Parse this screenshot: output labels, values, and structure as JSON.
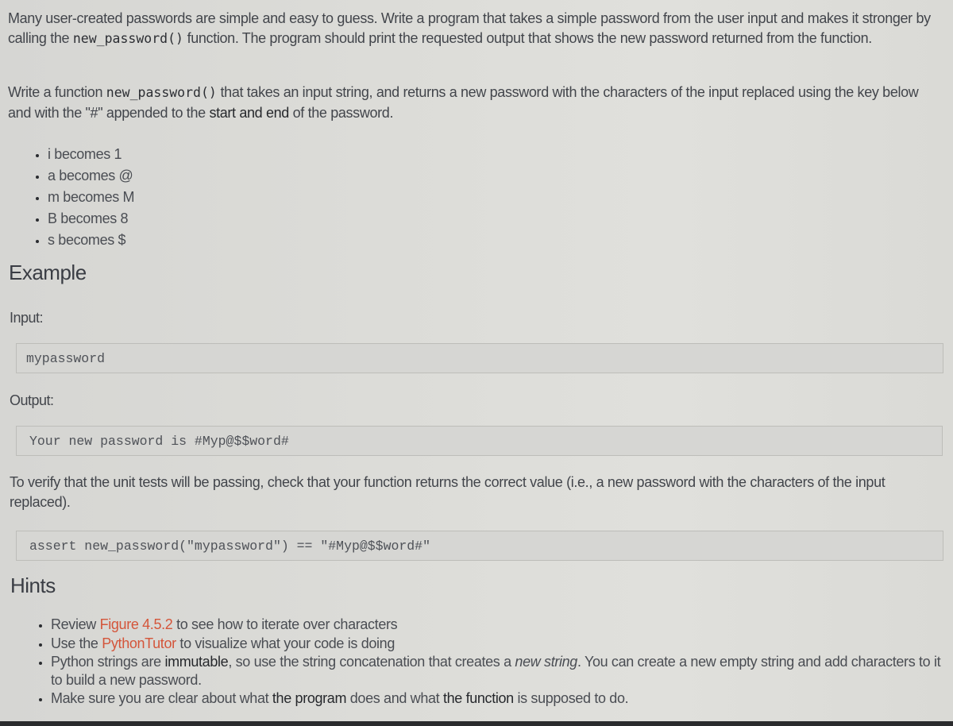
{
  "intro": {
    "part1": "Many user-created passwords are simple and easy to guess. Write a program that takes a simple password from the user input and makes it stronger by calling the ",
    "function_name": "new_password()",
    "part2": " function. The program should print the requested output that shows the new password returned from the function."
  },
  "task": {
    "part1": "Write a function ",
    "function_name": "new_password()",
    "part2": " that takes an input string, and returns a new password with the characters of the input replaced using the key below and with the \"#\" appended to the ",
    "bold": "start and end",
    "part3": " of the password."
  },
  "key_rules": [
    "i becomes 1",
    "a becomes @",
    "m becomes M",
    "B becomes 8",
    "s becomes $"
  ],
  "example": {
    "heading": "Example",
    "input_label": "Input:",
    "input_value": "mypassword",
    "output_label": "Output:",
    "output_value": "Your new password is #Myp@$$word#"
  },
  "verify": {
    "text": "To verify that the unit tests will be passing, check that your function returns the correct value (i.e., a new password with the characters of the input replaced).",
    "assert_code": "assert new_password(\"mypassword\") == \"#Myp@$$word#\""
  },
  "hints": {
    "heading": "Hints",
    "items": [
      {
        "pre": "Review ",
        "link": "Figure 4.5.2",
        "post": " to see how to iterate over characters"
      },
      {
        "pre": "Use the ",
        "link": "PythonTutor",
        "post": " to visualize what your code is doing"
      },
      {
        "pre": "Python strings are ",
        "bold": "immutable",
        "mid": ", so use the string concatenation that creates a ",
        "italic": "new string",
        "post": ". You can create a new empty string and add characters to it to build a new password."
      },
      {
        "pre": "Make sure you are clear about what ",
        "bold1": "the program",
        "mid": " does and what ",
        "bold2": "the function",
        "post": " is supposed to do."
      }
    ]
  },
  "colors": {
    "link": "#d4553a",
    "text": "#42454b",
    "code_box_bg": "#d6d6d3"
  }
}
